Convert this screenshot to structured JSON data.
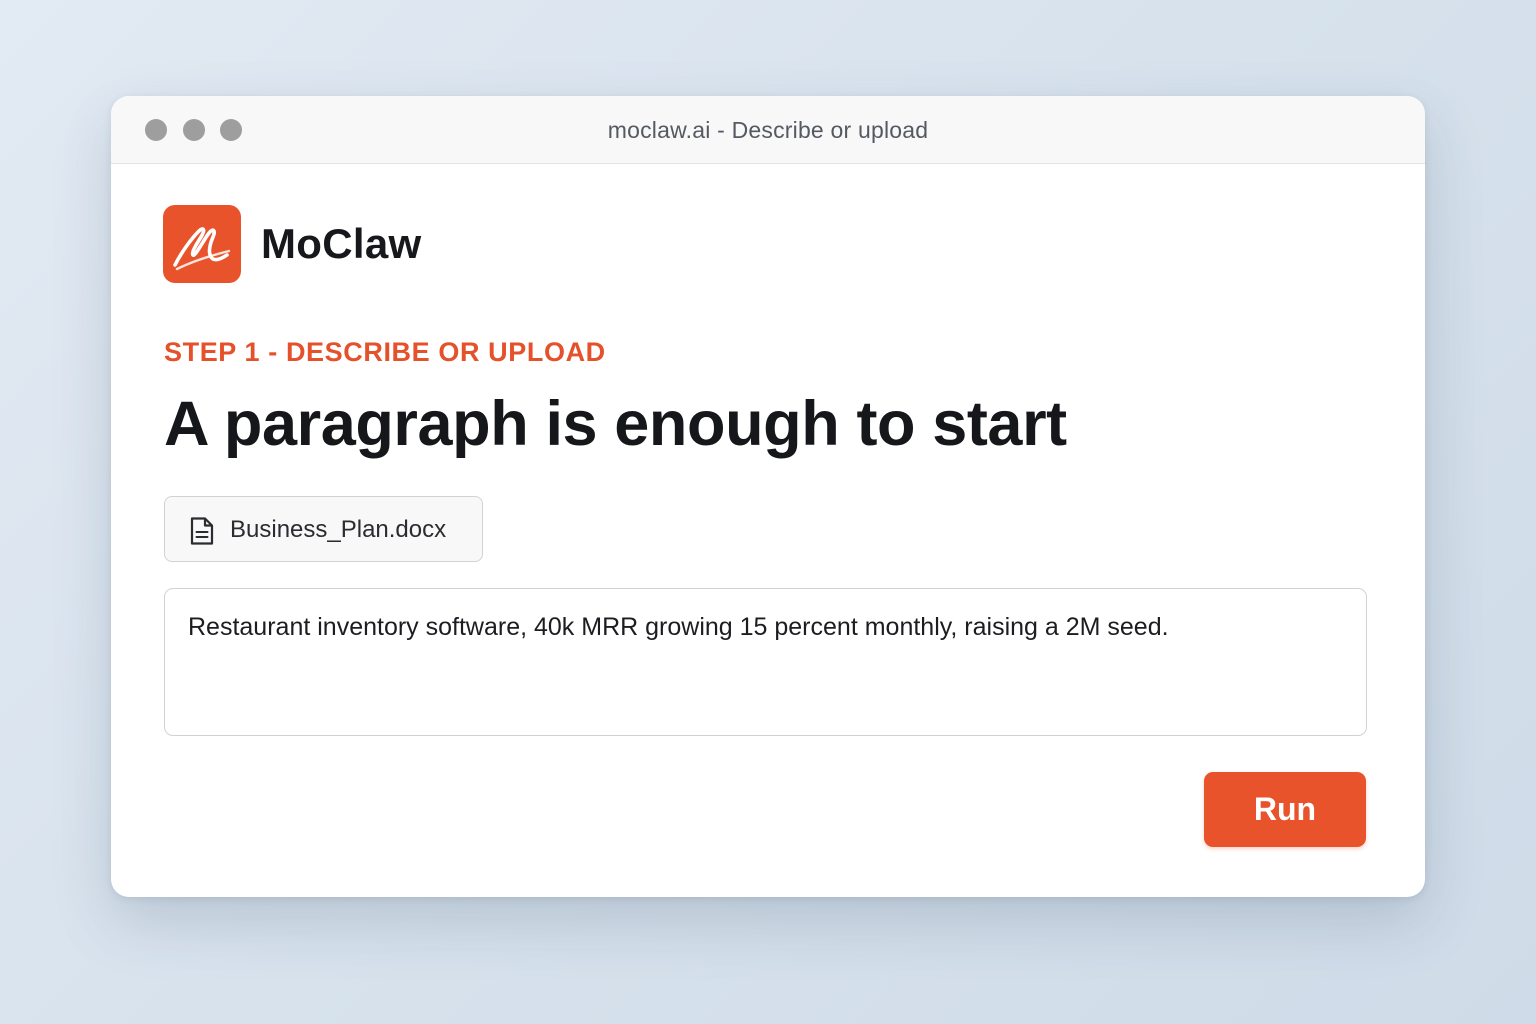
{
  "window": {
    "title": "moclaw.ai - Describe or upload"
  },
  "brand": {
    "name": "MoClaw",
    "logo_icon": "moclaw-scribble-logo-icon",
    "accent_color": "#e9532b"
  },
  "step": {
    "label": "STEP 1 - DESCRIBE OR UPLOAD",
    "headline": "A paragraph is enough to start"
  },
  "attachment": {
    "icon": "document-icon",
    "filename": "Business_Plan.docx"
  },
  "prompt": {
    "value": "Restaurant inventory software, 40k MRR growing 15 percent monthly, raising a 2M seed."
  },
  "actions": {
    "run_label": "Run"
  }
}
